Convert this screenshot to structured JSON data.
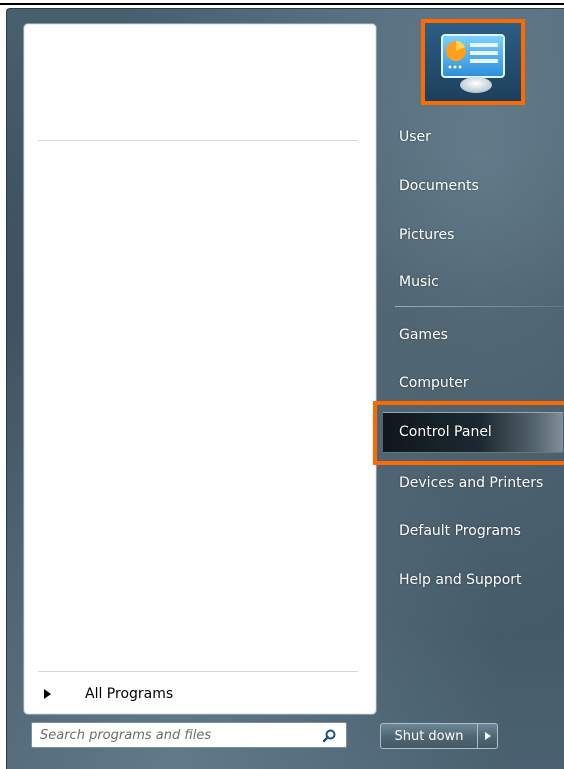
{
  "start_menu": {
    "left_pane": {
      "all_programs_label": "All Programs",
      "search_placeholder": "Search programs and files"
    },
    "right_pane": {
      "user_picture_icon": "control-panel-user-picture-icon",
      "items": [
        {
          "label": "User"
        },
        {
          "label": "Documents"
        },
        {
          "label": "Pictures"
        },
        {
          "label": "Music"
        },
        {
          "label": "Games"
        },
        {
          "label": "Computer"
        },
        {
          "label": "Control Panel"
        },
        {
          "label": "Devices and Printers"
        },
        {
          "label": "Default Programs"
        },
        {
          "label": "Help and Support"
        }
      ]
    },
    "shutdown": {
      "label": "Shut down"
    },
    "highlight_color": "#ff6a00"
  }
}
